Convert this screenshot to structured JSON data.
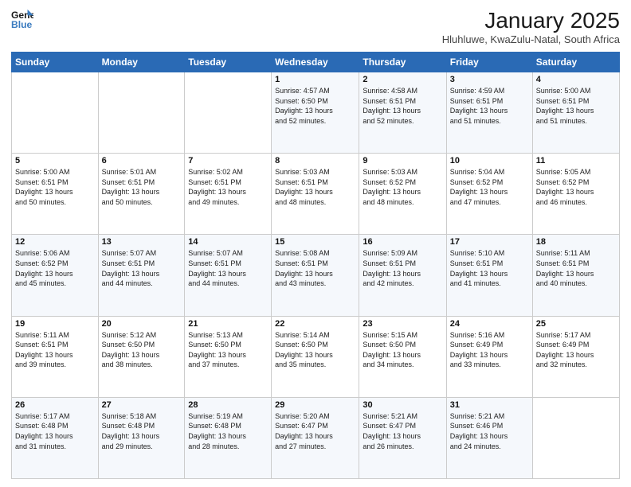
{
  "header": {
    "logo_line1": "General",
    "logo_line2": "Blue",
    "title": "January 2025",
    "location": "Hluhluwe, KwaZulu-Natal, South Africa"
  },
  "weekdays": [
    "Sunday",
    "Monday",
    "Tuesday",
    "Wednesday",
    "Thursday",
    "Friday",
    "Saturday"
  ],
  "weeks": [
    [
      {
        "day": "",
        "info": ""
      },
      {
        "day": "",
        "info": ""
      },
      {
        "day": "",
        "info": ""
      },
      {
        "day": "1",
        "info": "Sunrise: 4:57 AM\nSunset: 6:50 PM\nDaylight: 13 hours\nand 52 minutes."
      },
      {
        "day": "2",
        "info": "Sunrise: 4:58 AM\nSunset: 6:51 PM\nDaylight: 13 hours\nand 52 minutes."
      },
      {
        "day": "3",
        "info": "Sunrise: 4:59 AM\nSunset: 6:51 PM\nDaylight: 13 hours\nand 51 minutes."
      },
      {
        "day": "4",
        "info": "Sunrise: 5:00 AM\nSunset: 6:51 PM\nDaylight: 13 hours\nand 51 minutes."
      }
    ],
    [
      {
        "day": "5",
        "info": "Sunrise: 5:00 AM\nSunset: 6:51 PM\nDaylight: 13 hours\nand 50 minutes."
      },
      {
        "day": "6",
        "info": "Sunrise: 5:01 AM\nSunset: 6:51 PM\nDaylight: 13 hours\nand 50 minutes."
      },
      {
        "day": "7",
        "info": "Sunrise: 5:02 AM\nSunset: 6:51 PM\nDaylight: 13 hours\nand 49 minutes."
      },
      {
        "day": "8",
        "info": "Sunrise: 5:03 AM\nSunset: 6:51 PM\nDaylight: 13 hours\nand 48 minutes."
      },
      {
        "day": "9",
        "info": "Sunrise: 5:03 AM\nSunset: 6:52 PM\nDaylight: 13 hours\nand 48 minutes."
      },
      {
        "day": "10",
        "info": "Sunrise: 5:04 AM\nSunset: 6:52 PM\nDaylight: 13 hours\nand 47 minutes."
      },
      {
        "day": "11",
        "info": "Sunrise: 5:05 AM\nSunset: 6:52 PM\nDaylight: 13 hours\nand 46 minutes."
      }
    ],
    [
      {
        "day": "12",
        "info": "Sunrise: 5:06 AM\nSunset: 6:52 PM\nDaylight: 13 hours\nand 45 minutes."
      },
      {
        "day": "13",
        "info": "Sunrise: 5:07 AM\nSunset: 6:51 PM\nDaylight: 13 hours\nand 44 minutes."
      },
      {
        "day": "14",
        "info": "Sunrise: 5:07 AM\nSunset: 6:51 PM\nDaylight: 13 hours\nand 44 minutes."
      },
      {
        "day": "15",
        "info": "Sunrise: 5:08 AM\nSunset: 6:51 PM\nDaylight: 13 hours\nand 43 minutes."
      },
      {
        "day": "16",
        "info": "Sunrise: 5:09 AM\nSunset: 6:51 PM\nDaylight: 13 hours\nand 42 minutes."
      },
      {
        "day": "17",
        "info": "Sunrise: 5:10 AM\nSunset: 6:51 PM\nDaylight: 13 hours\nand 41 minutes."
      },
      {
        "day": "18",
        "info": "Sunrise: 5:11 AM\nSunset: 6:51 PM\nDaylight: 13 hours\nand 40 minutes."
      }
    ],
    [
      {
        "day": "19",
        "info": "Sunrise: 5:11 AM\nSunset: 6:51 PM\nDaylight: 13 hours\nand 39 minutes."
      },
      {
        "day": "20",
        "info": "Sunrise: 5:12 AM\nSunset: 6:50 PM\nDaylight: 13 hours\nand 38 minutes."
      },
      {
        "day": "21",
        "info": "Sunrise: 5:13 AM\nSunset: 6:50 PM\nDaylight: 13 hours\nand 37 minutes."
      },
      {
        "day": "22",
        "info": "Sunrise: 5:14 AM\nSunset: 6:50 PM\nDaylight: 13 hours\nand 35 minutes."
      },
      {
        "day": "23",
        "info": "Sunrise: 5:15 AM\nSunset: 6:50 PM\nDaylight: 13 hours\nand 34 minutes."
      },
      {
        "day": "24",
        "info": "Sunrise: 5:16 AM\nSunset: 6:49 PM\nDaylight: 13 hours\nand 33 minutes."
      },
      {
        "day": "25",
        "info": "Sunrise: 5:17 AM\nSunset: 6:49 PM\nDaylight: 13 hours\nand 32 minutes."
      }
    ],
    [
      {
        "day": "26",
        "info": "Sunrise: 5:17 AM\nSunset: 6:48 PM\nDaylight: 13 hours\nand 31 minutes."
      },
      {
        "day": "27",
        "info": "Sunrise: 5:18 AM\nSunset: 6:48 PM\nDaylight: 13 hours\nand 29 minutes."
      },
      {
        "day": "28",
        "info": "Sunrise: 5:19 AM\nSunset: 6:48 PM\nDaylight: 13 hours\nand 28 minutes."
      },
      {
        "day": "29",
        "info": "Sunrise: 5:20 AM\nSunset: 6:47 PM\nDaylight: 13 hours\nand 27 minutes."
      },
      {
        "day": "30",
        "info": "Sunrise: 5:21 AM\nSunset: 6:47 PM\nDaylight: 13 hours\nand 26 minutes."
      },
      {
        "day": "31",
        "info": "Sunrise: 5:21 AM\nSunset: 6:46 PM\nDaylight: 13 hours\nand 24 minutes."
      },
      {
        "day": "",
        "info": ""
      }
    ]
  ]
}
